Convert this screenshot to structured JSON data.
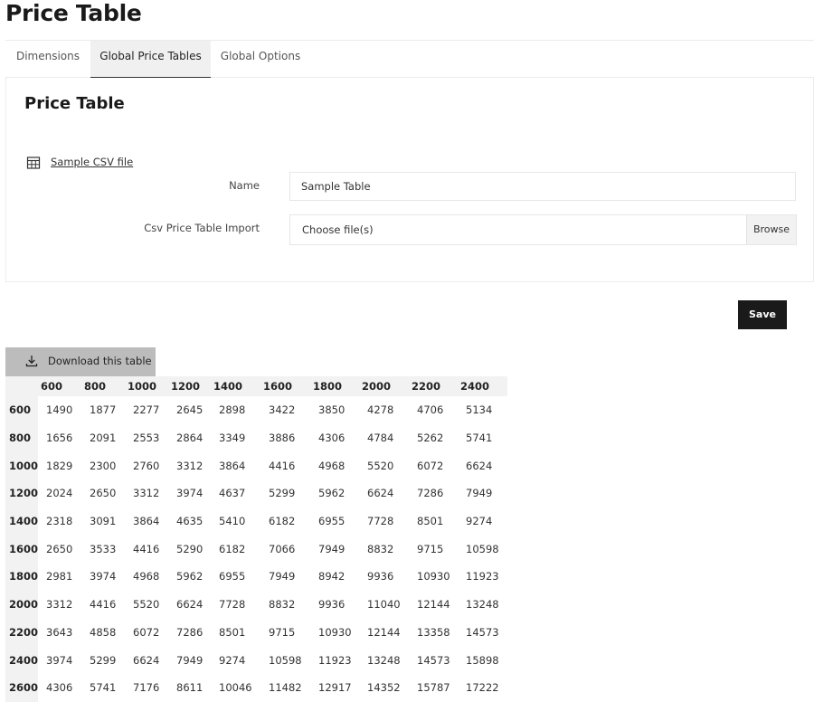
{
  "page": {
    "title": "Price Table"
  },
  "tabs": [
    {
      "label": "Dimensions",
      "active": false
    },
    {
      "label": "Global Price Tables",
      "active": true
    },
    {
      "label": "Global Options",
      "active": false
    }
  ],
  "card": {
    "title": "Price Table",
    "sample_link": "Sample CSV file",
    "sample_icon": "table-grid-icon",
    "name_label": "Name",
    "name_value": "Sample Table",
    "csv_label": "Csv Price Table Import",
    "file_placeholder": "Choose file(s)",
    "browse_label": "Browse"
  },
  "actions": {
    "save_label": "Save",
    "download_label": "Download this table",
    "download_icon": "download-icon"
  },
  "price_table": {
    "columns": [
      "600",
      "800",
      "1000",
      "1200",
      "1400",
      "1600",
      "1800",
      "2000",
      "2200",
      "2400"
    ],
    "rows": [
      {
        "label": "600",
        "values": [
          "1490",
          "1877",
          "2277",
          "2645",
          "2898",
          "3422",
          "3850",
          "4278",
          "4706",
          "5134"
        ]
      },
      {
        "label": "800",
        "values": [
          "1656",
          "2091",
          "2553",
          "2864",
          "3349",
          "3886",
          "4306",
          "4784",
          "5262",
          "5741"
        ]
      },
      {
        "label": "1000",
        "values": [
          "1829",
          "2300",
          "2760",
          "3312",
          "3864",
          "4416",
          "4968",
          "5520",
          "6072",
          "6624"
        ]
      },
      {
        "label": "1200",
        "values": [
          "2024",
          "2650",
          "3312",
          "3974",
          "4637",
          "5299",
          "5962",
          "6624",
          "7286",
          "7949"
        ]
      },
      {
        "label": "1400",
        "values": [
          "2318",
          "3091",
          "3864",
          "4635",
          "5410",
          "6182",
          "6955",
          "7728",
          "8501",
          "9274"
        ]
      },
      {
        "label": "1600",
        "values": [
          "2650",
          "3533",
          "4416",
          "5290",
          "6182",
          "7066",
          "7949",
          "8832",
          "9715",
          "10598"
        ]
      },
      {
        "label": "1800",
        "values": [
          "2981",
          "3974",
          "4968",
          "5962",
          "6955",
          "7949",
          "8942",
          "9936",
          "10930",
          "11923"
        ]
      },
      {
        "label": "2000",
        "values": [
          "3312",
          "4416",
          "5520",
          "6624",
          "7728",
          "8832",
          "9936",
          "11040",
          "12144",
          "13248"
        ]
      },
      {
        "label": "2200",
        "values": [
          "3643",
          "4858",
          "6072",
          "7286",
          "8501",
          "9715",
          "10930",
          "12144",
          "13358",
          "14573"
        ]
      },
      {
        "label": "2400",
        "values": [
          "3974",
          "5299",
          "6624",
          "7949",
          "9274",
          "10598",
          "11923",
          "13248",
          "14573",
          "15898"
        ]
      },
      {
        "label": "2600",
        "values": [
          "4306",
          "5741",
          "7176",
          "8611",
          "10046",
          "11482",
          "12917",
          "14352",
          "15787",
          "17222"
        ]
      }
    ]
  }
}
